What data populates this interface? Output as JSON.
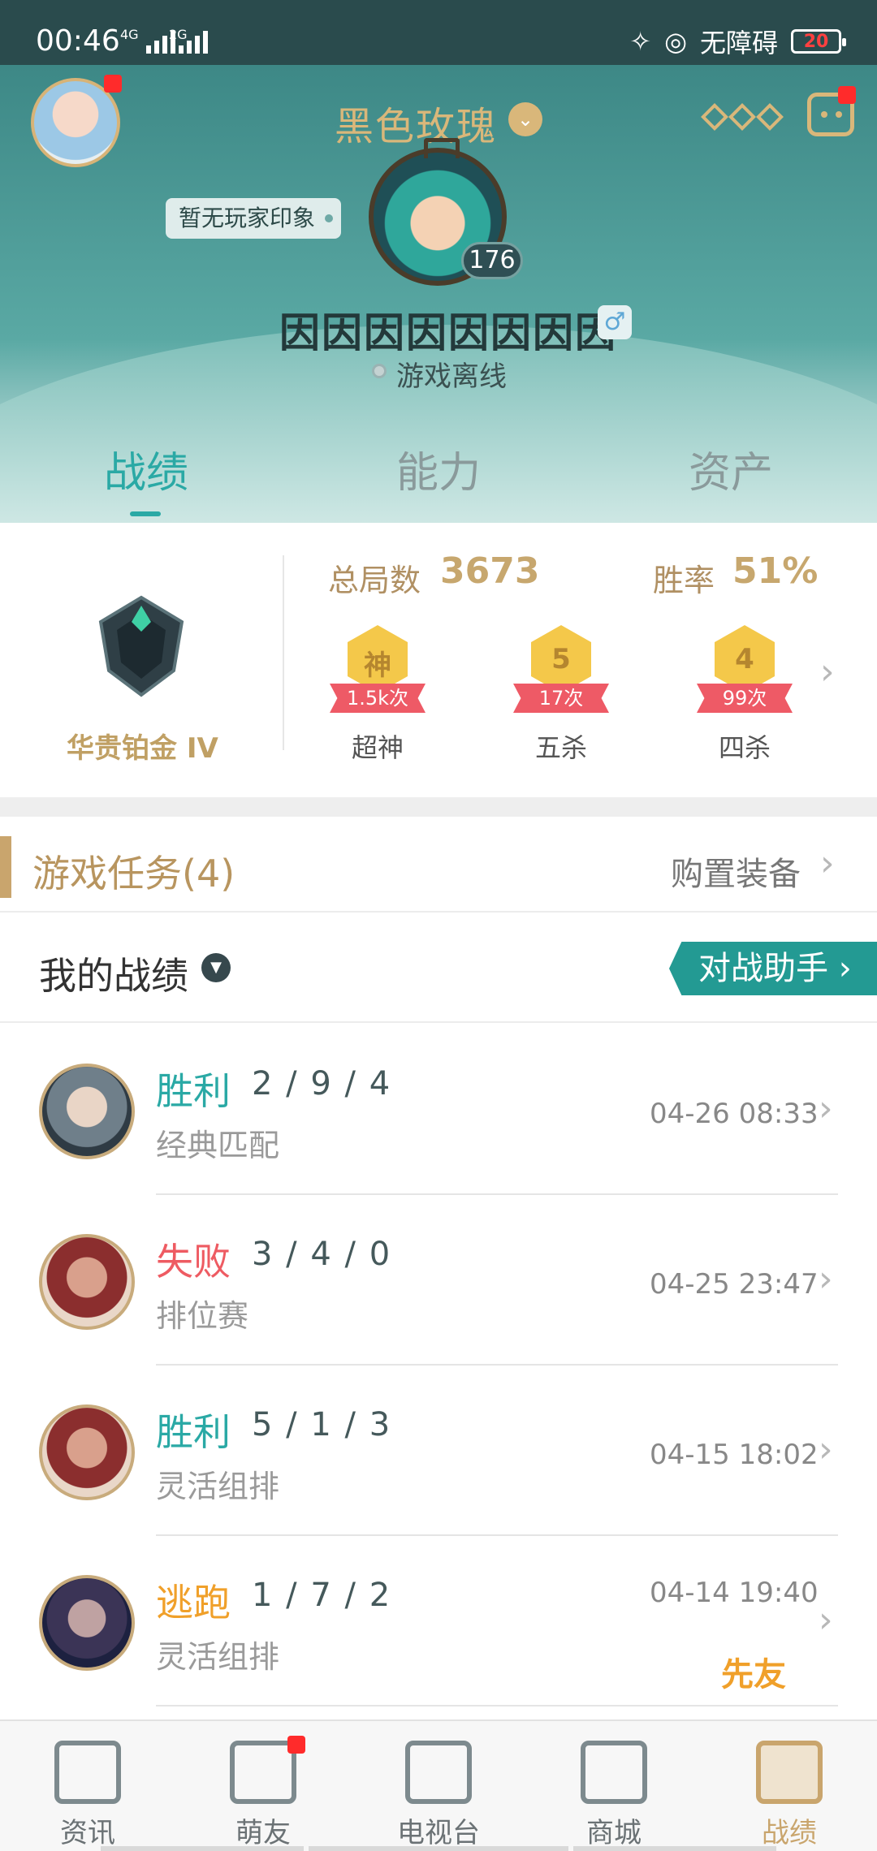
{
  "status_bar": {
    "time": "00:46",
    "signal1": "4G",
    "signal2": "2G",
    "accessibility": "无障碍",
    "battery": "20"
  },
  "header": {
    "nickname": "黑色玫瑰",
    "impression": "暂无玩家印象",
    "level": "176",
    "player_name": "因因因因因因因因",
    "gender_symbol": "♂",
    "status": "游戏离线"
  },
  "tabs": [
    "战绩",
    "能力",
    "资产"
  ],
  "stats": {
    "rank": "华贵铂金 IV",
    "total_label": "总局数",
    "total_value": "3673",
    "winrate_label": "胜率",
    "winrate_value": "51%",
    "medals": [
      {
        "icon": "神",
        "count": "1.5k次",
        "label": "超神"
      },
      {
        "icon": "5",
        "count": "17次",
        "label": "五杀"
      },
      {
        "icon": "4",
        "count": "99次",
        "label": "四杀"
      }
    ]
  },
  "tasks": {
    "title": "游戏任务(4)",
    "right": "购置装备"
  },
  "records": {
    "title": "我的战绩",
    "assistant": "对战助手",
    "matches": [
      {
        "result": "胜利",
        "kda": "2 / 9 / 4",
        "mode": "经典匹配",
        "time": "04-26 08:33",
        "status": "win"
      },
      {
        "result": "失败",
        "kda": "3 / 4 / 0",
        "mode": "排位赛",
        "time": "04-25 23:47",
        "status": "lose"
      },
      {
        "result": "胜利",
        "kda": "5 / 1 / 3",
        "mode": "灵活组排",
        "time": "04-15 18:02",
        "status": "win"
      },
      {
        "result": "逃跑",
        "kda": "1 / 7 / 2",
        "mode": "灵活组排",
        "time": "04-14 19:40",
        "status": "escape",
        "friend_tag": "先友"
      }
    ]
  },
  "bottom_nav": [
    "资讯",
    "萌友",
    "电视台",
    "商城",
    "战绩"
  ],
  "colors": {
    "accent": "#2aa9a5",
    "gold": "#c9a56d",
    "lose": "#ee5b62",
    "escape": "#f0a02a"
  }
}
